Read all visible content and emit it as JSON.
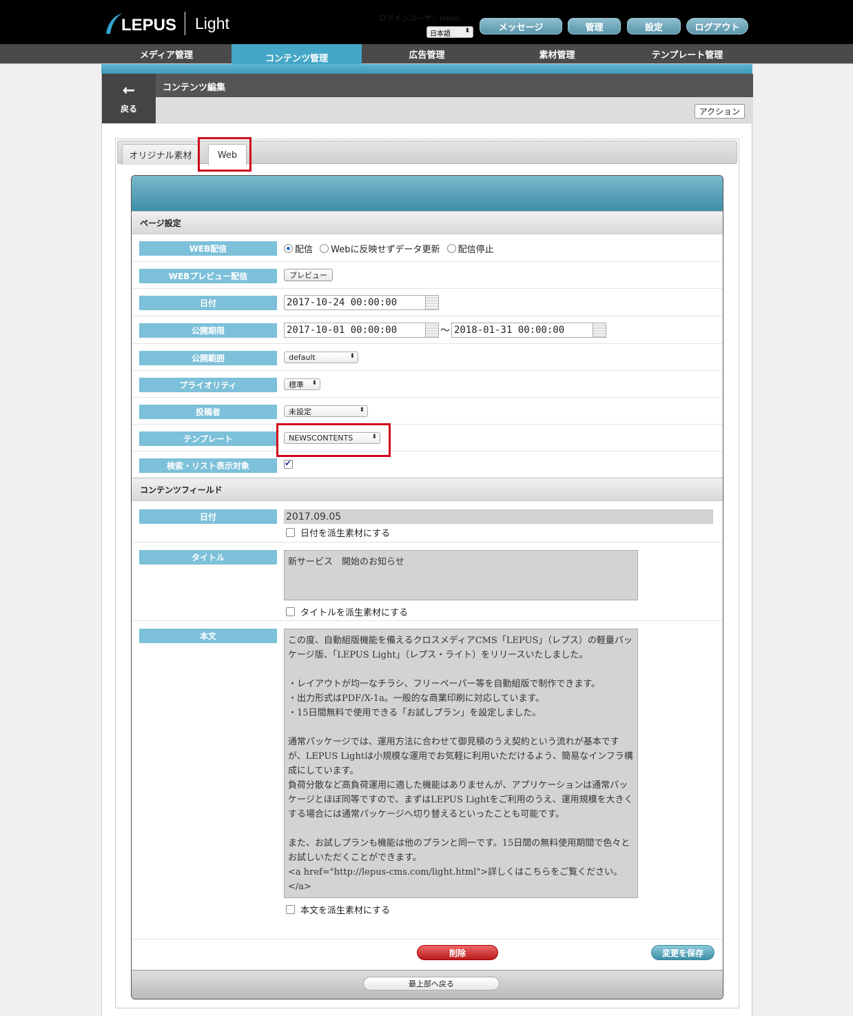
{
  "header": {
    "logo_text": "LEPUS",
    "product": "Light",
    "login_info": "ログインユーザ：lepus",
    "language": "日本語",
    "buttons": {
      "message": "メッセージ",
      "admin": "管理",
      "settings": "設定",
      "logout": "ログアウト"
    },
    "accent": "#45a7c7"
  },
  "nav": {
    "items": [
      {
        "label": "メディア管理"
      },
      {
        "label": "コンテンツ管理",
        "active": true
      },
      {
        "label": "広告管理"
      },
      {
        "label": "素材管理"
      },
      {
        "label": "テンプレート管理"
      }
    ]
  },
  "page": {
    "back_label": "戻る",
    "title": "コンテンツ編集",
    "action_label": "アクション"
  },
  "tabs": [
    {
      "label": "オリジナル素材"
    },
    {
      "label": "Web",
      "active": true
    }
  ],
  "page_settings": {
    "section_title": "ページ設定",
    "web_delivery": {
      "label": "WEB配信",
      "options": [
        "配信",
        "Webに反映せずデータ更新",
        "配信停止"
      ],
      "selected": "配信"
    },
    "web_preview": {
      "label": "WEBプレビュー配信",
      "button": "プレビュー"
    },
    "date": {
      "label": "日付",
      "value": "2017-10-24 00:00:00"
    },
    "period": {
      "label": "公開期限",
      "from": "2017-10-01 00:00:00",
      "separator": "〜",
      "to": "2018-01-31 00:00:00"
    },
    "scope": {
      "label": "公開範囲",
      "value": "default"
    },
    "priority": {
      "label": "プライオリティ",
      "value": "標準"
    },
    "author": {
      "label": "投稿者",
      "value": "未設定"
    },
    "template": {
      "label": "テンプレート",
      "value": "NEWSCONTENTS"
    },
    "searchable": {
      "label": "検索・リスト表示対象",
      "checked": true
    }
  },
  "content_fields": {
    "section_title": "コンテンツフィールド",
    "date": {
      "label": "日付",
      "value": "2017.09.05",
      "derive_label": "日付を派生素材にする"
    },
    "title": {
      "label": "タイトル",
      "value": "新サービス　開始のお知らせ",
      "derive_label": "タイトルを派生素材にする"
    },
    "body": {
      "label": "本文",
      "value": "この度、自動組版機能を備えるクロスメディアCMS「LEPUS」（レプス）の軽量パッケージ版、「LEPUS Light」（レプス・ライト）をリリースいたしました。\n\n・レイアウトが均一なチラシ、フリーペーパー等を自動組版で制作できます。\n・出力形式はPDF/X-1a。一般的な商業印刷に対応しています。\n・15日間無料で使用できる「お試しプラン」を設定しました。\n\n通常パッケージでは、運用方法に合わせて御見積のうえ契約という流れが基本ですが、LEPUS Lightは小規模な運用でお気軽に利用いただけるよう、簡易なインフラ構成にしています。\n負荷分散など高負荷運用に適した機能はありませんが、アプリケーションは通常パッケージとほぼ同等ですので、まずはLEPUS Lightをご利用のうえ、運用規模を大きくする場合には通常パッケージへ切り替えるといったことも可能です。\n\nまた、お試しプランも機能は他のプランと同一です。15日間の無料使用期間で色々とお試しいただくことができます。\n<a href=\"http://lepus-cms.com/light.html\">詳しくはこちらをご覧ください。</a>",
      "derive_label": "本文を派生素材にする"
    }
  },
  "footer": {
    "delete": "削除",
    "save": "変更を保存",
    "to_top": "最上部へ戻る"
  }
}
